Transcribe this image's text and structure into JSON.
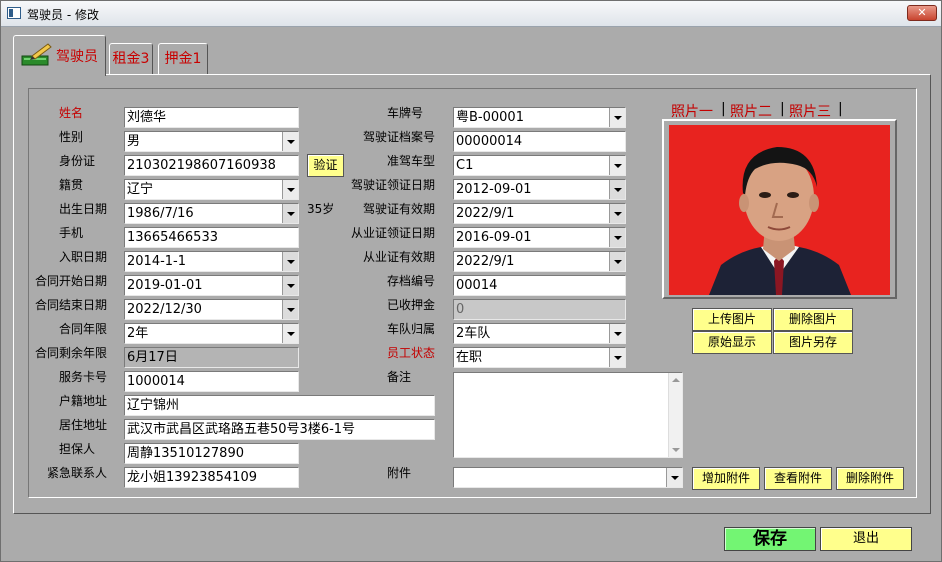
{
  "window": {
    "title": "驾驶员 - 修改",
    "close": "✕"
  },
  "tabs": [
    {
      "label": "驾驶员"
    },
    {
      "label": "租金3"
    },
    {
      "label": "押金1"
    }
  ],
  "form": {
    "name": {
      "label": "姓名",
      "value": "刘德华"
    },
    "gender": {
      "label": "性别",
      "value": "男"
    },
    "id_card": {
      "label": "身份证",
      "value": "210302198607160938"
    },
    "verify_button": "验证",
    "native": {
      "label": "籍贯",
      "value": "辽宁"
    },
    "birth": {
      "label": "出生日期",
      "value": "1986/7/16",
      "age": "35岁"
    },
    "phone": {
      "label": "手机",
      "value": "13665466533"
    },
    "join_date": {
      "label": "入职日期",
      "value": "2014-1-1"
    },
    "contract_start": {
      "label": "合同开始日期",
      "value": "2019-01-01"
    },
    "contract_end": {
      "label": "合同结束日期",
      "value": "2022/12/30"
    },
    "contract_years": {
      "label": "合同年限",
      "value": "2年"
    },
    "contract_remaining": {
      "label": "合同剩余年限",
      "value": "6月17日"
    },
    "service_card": {
      "label": "服务卡号",
      "value": "1000014"
    },
    "household": {
      "label": "户籍地址",
      "value": "辽宁锦州"
    },
    "address": {
      "label": "居住地址",
      "value": "武汉市武昌区武珞路五巷50号3楼6-1号"
    },
    "guarantor": {
      "label": "担保人",
      "value": "周静13510127890"
    },
    "emergency": {
      "label": "紧急联系人",
      "value": "龙小姐13923854109"
    },
    "plate": {
      "label": "车牌号",
      "value": "粤B-00001"
    },
    "license_archive": {
      "label": "驾驶证档案号",
      "value": "00000014"
    },
    "vehicle_class": {
      "label": "准驾车型",
      "value": "C1"
    },
    "license_issue": {
      "label": "驾驶证领证日期",
      "value": "2012-09-01"
    },
    "license_valid": {
      "label": "驾驶证有效期",
      "value": "2022/9/1"
    },
    "qual_issue": {
      "label": "从业证领证日期",
      "value": "2016-09-01"
    },
    "qual_valid": {
      "label": "从业证有效期",
      "value": "2022/9/1"
    },
    "archive_no": {
      "label": "存档编号",
      "value": "00014"
    },
    "deposit": {
      "label": "已收押金",
      "value": "0"
    },
    "team": {
      "label": "车队归属",
      "value": "2车队"
    },
    "status": {
      "label": "员工状态",
      "value": "在职"
    },
    "notes": {
      "label": "备注",
      "value": ""
    },
    "attachment": {
      "label": "附件",
      "value": ""
    }
  },
  "photo": {
    "tabs": [
      "照片一",
      "照片二",
      "照片三"
    ],
    "buttons": {
      "upload": "上传图片",
      "delete": "删除图片",
      "original": "原始显示",
      "save_as": "图片另存"
    }
  },
  "attachment_buttons": {
    "add": "增加附件",
    "view": "查看附件",
    "delete": "删除附件"
  },
  "footer": {
    "save": "保存",
    "exit": "退出"
  },
  "colors": {
    "label_red": "#c40000",
    "button_yellow": "#ffff8c",
    "save_green": "#73f573",
    "photo_bg": "#e8231f"
  }
}
